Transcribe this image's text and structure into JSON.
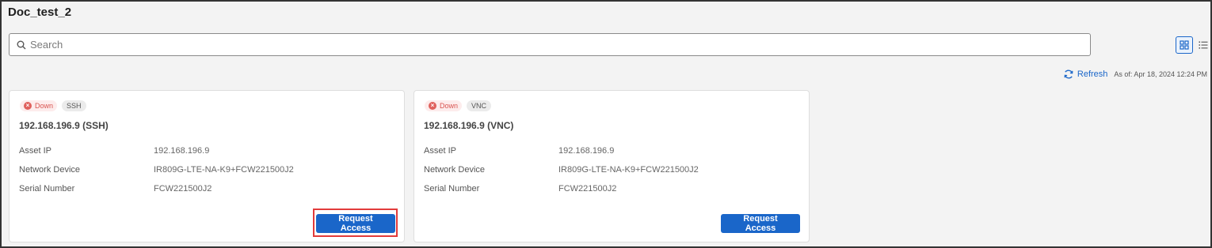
{
  "page": {
    "title": "Doc_test_2"
  },
  "search": {
    "placeholder": "Search"
  },
  "toolbar": {
    "refresh_label": "Refresh",
    "as_of": "As of: Apr 18, 2024 12:24 PM"
  },
  "cards": [
    {
      "status": "Down",
      "protocol": "SSH",
      "title": "192.168.196.9 (SSH)",
      "fields": [
        {
          "label": "Asset IP",
          "value": "192.168.196.9"
        },
        {
          "label": "Network Device",
          "value": "IR809G-LTE-NA-K9+FCW221500J2"
        },
        {
          "label": "Serial Number",
          "value": "FCW221500J2"
        }
      ],
      "button": "Request Access"
    },
    {
      "status": "Down",
      "protocol": "VNC",
      "title": "192.168.196.9 (VNC)",
      "fields": [
        {
          "label": "Asset IP",
          "value": "192.168.196.9"
        },
        {
          "label": "Network Device",
          "value": "IR809G-LTE-NA-K9+FCW221500J2"
        },
        {
          "label": "Serial Number",
          "value": "FCW221500J2"
        }
      ],
      "button": "Request Access"
    }
  ],
  "colors": {
    "accent": "#1a66c9",
    "status_down": "#d9534f",
    "highlight": "#e23b3b"
  }
}
